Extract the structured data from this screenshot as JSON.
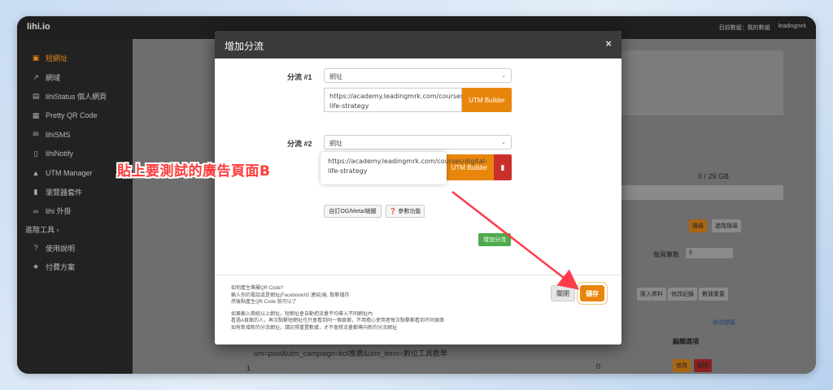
{
  "app": {
    "brand": "lihi.io",
    "top_right_1": "目前數組：我的數組",
    "top_right_2": "leadingmrk"
  },
  "sidebar": {
    "items": [
      {
        "label": "短網址",
        "icon": "link-box-icon",
        "glyph": "▣"
      },
      {
        "label": "網域",
        "icon": "external-link-icon",
        "glyph": "↗"
      },
      {
        "label": "lihiStatus 個人網頁",
        "icon": "page-icon",
        "glyph": "▤"
      },
      {
        "label": "Pretty QR Code",
        "icon": "qr-icon",
        "glyph": "▦"
      },
      {
        "label": "lihiSMS",
        "icon": "mail-icon",
        "glyph": "✉"
      },
      {
        "label": "lihiNotify",
        "icon": "phone-icon",
        "glyph": "▯"
      },
      {
        "label": "UTM Manager",
        "icon": "utm-icon",
        "glyph": "▲"
      },
      {
        "label": "瀏覽器套件",
        "icon": "bookmark-icon",
        "glyph": "▮"
      },
      {
        "label": "lihi 外掛",
        "icon": "plugin-icon",
        "glyph": "∞"
      }
    ],
    "section": "進階工具 ›",
    "items2": [
      {
        "label": "使用說明",
        "icon": "help-icon",
        "glyph": "?"
      },
      {
        "label": "付費方案",
        "icon": "star-icon",
        "glyph": "★"
      }
    ]
  },
  "background": {
    "storage": "0 / 29 GB",
    "search_btn": "搜尋",
    "adv_search_btn": "進階搜尋",
    "per_page_label": "每頁筆數",
    "per_page_value": "5",
    "tabs": [
      "匯入資料",
      "修改紀錄",
      "數據重置"
    ],
    "edit_label": "修改標籤",
    "col_edit": "編輯選項",
    "edit_btn": "修改",
    "delete_btn": "刪除",
    "row_num": "1",
    "row_count": "0",
    "row_url_tail": "um=post&utm_campaign=kol推廣&utm_term=數位工具教學"
  },
  "modal": {
    "title": "增加分流",
    "close": "×",
    "split1": {
      "label": "分流 #1",
      "type": "網址",
      "url": "https://academy.leadingmrk.com/courses/digital-life-strategy",
      "utm": "UTM Builder"
    },
    "split2": {
      "label": "分流 #2",
      "type": "網址",
      "url": "https://academy.leadingmrk.com/courses/digital-life-strategy",
      "utm": "UTM Builder"
    },
    "og_btn": "自訂OG/Meta/縮圖",
    "param_btn": "參數功能",
    "add_split_btn": "增加分流",
    "help": [
      "如何產生專屬QR Code?",
      "輸入你的電話或是網址(Facebook/IG 連結)後, 點擊儲存",
      "然後點產生QR Code 就可以了",
      "",
      "如果輸入兩組以上網址，短網址會自動把流量平均導入不同網址內",
      "看過A頁面的人，再次點擊短網址也只會看到同一個頁面，不用擔心使用者每次點擊都看到不同頁面",
      "如有新增新的分流網址，請記得重置數據，才不會將流量都導向新的分流網址"
    ],
    "footer_close": "關閉",
    "footer_save": "儲存"
  },
  "annotation": {
    "callout": "貼上要測試的廣告頁面B"
  },
  "colors": {
    "accent": "#e8860c",
    "danger": "#c9302c",
    "success": "#4caa4c",
    "arrow": "#ff3b4a"
  }
}
